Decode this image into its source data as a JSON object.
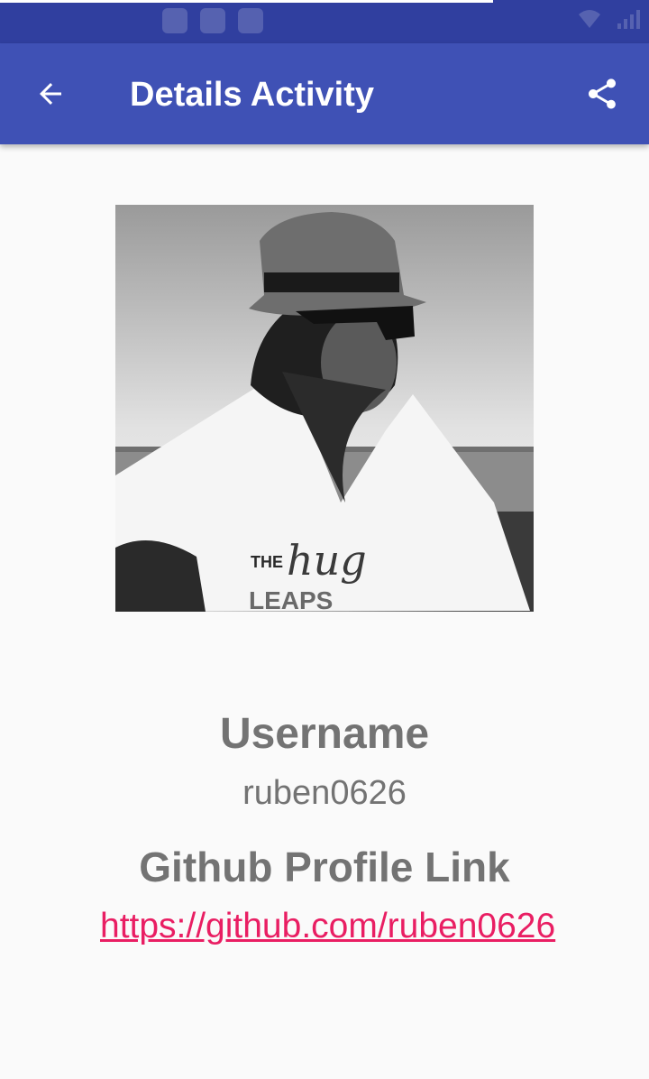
{
  "app_bar": {
    "title": "Details Activity",
    "back_icon": "arrow-back-icon",
    "share_icon": "share-icon",
    "color": "#3f51b5",
    "status_bar_color": "#303f9f"
  },
  "profile": {
    "avatar_alt": "avatar",
    "username_label": "Username",
    "username": "ruben0626",
    "github_label": "Github Profile Link",
    "github_url": "https://github.com/ruben0626",
    "link_color": "#e91e63"
  }
}
